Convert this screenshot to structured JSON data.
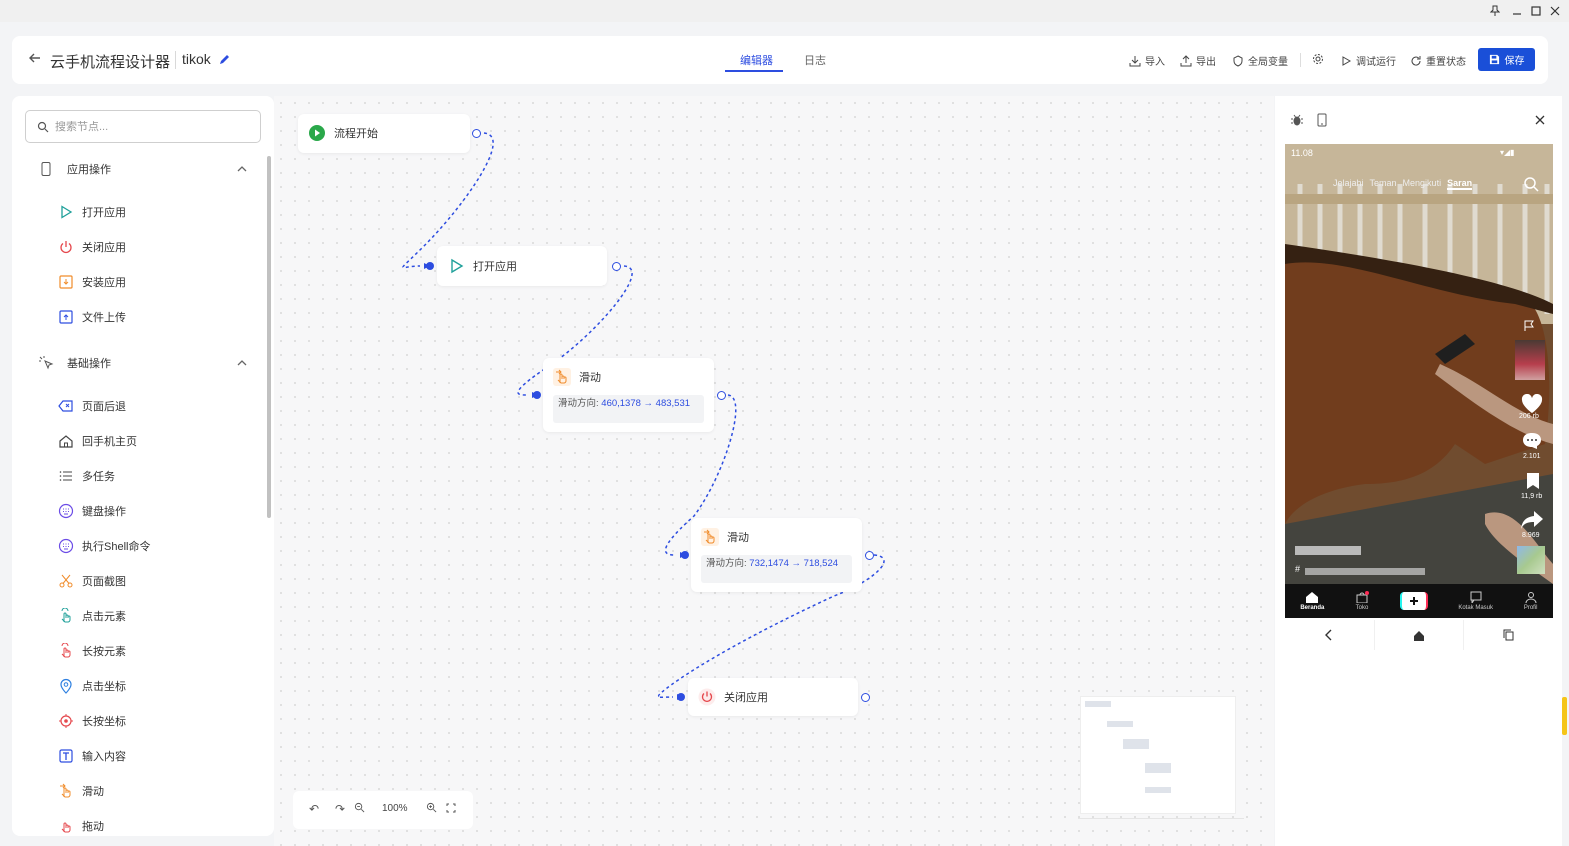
{
  "header": {
    "app_title": "云手机流程设计器",
    "flow_name": "tikok",
    "tabs": [
      {
        "label": "编辑器",
        "active": true
      },
      {
        "label": "日志",
        "active": false
      }
    ],
    "toolbar": {
      "import": "导入",
      "export": "导出",
      "globals": "全局变量",
      "debug_run": "调试运行",
      "reset_state": "重置状态",
      "save": "保存"
    }
  },
  "sidebar": {
    "search_placeholder": "搜索节点...",
    "groups": [
      {
        "label": "应用操作",
        "items": [
          "打开应用",
          "关闭应用",
          "安装应用",
          "文件上传"
        ]
      },
      {
        "label": "基础操作",
        "items": [
          "页面后退",
          "回手机主页",
          "多任务",
          "键盘操作",
          "执行Shell命令",
          "页面截图",
          "点击元素",
          "长按元素",
          "点击坐标",
          "长按坐标",
          "输入内容",
          "滑动",
          "拖动"
        ]
      }
    ]
  },
  "canvas": {
    "nodes": [
      {
        "label": "流程开始"
      },
      {
        "label": "打开应用"
      },
      {
        "label": "滑动",
        "detail_key": "滑动方向:",
        "detail_value": "460,1378 → 483,531"
      },
      {
        "label": "滑动",
        "detail_key": "滑动方向:",
        "detail_value": "732,1474 → 718,524"
      },
      {
        "label": "关闭应用"
      }
    ],
    "zoom": "100%"
  },
  "phone": {
    "time": "11.08",
    "feed_tabs": [
      "Jelajahi",
      "Teman",
      "Mengikuti",
      "Saran"
    ],
    "likes": "206 rb",
    "comments": "2.101",
    "saves": "11,9 rb",
    "shares": "8.969",
    "hashtag": "#",
    "bottom_tabs": [
      "Beranda",
      "Toko",
      "Kotak Masuk",
      "Profil"
    ]
  },
  "colors": {
    "accent": "#2d4de0",
    "save_button": "#1a4fd8",
    "green": "#2aa84a",
    "orange": "#f08c2b",
    "red": "#e5484d",
    "teal": "#1fa09a",
    "purple": "#6b4ce6"
  }
}
